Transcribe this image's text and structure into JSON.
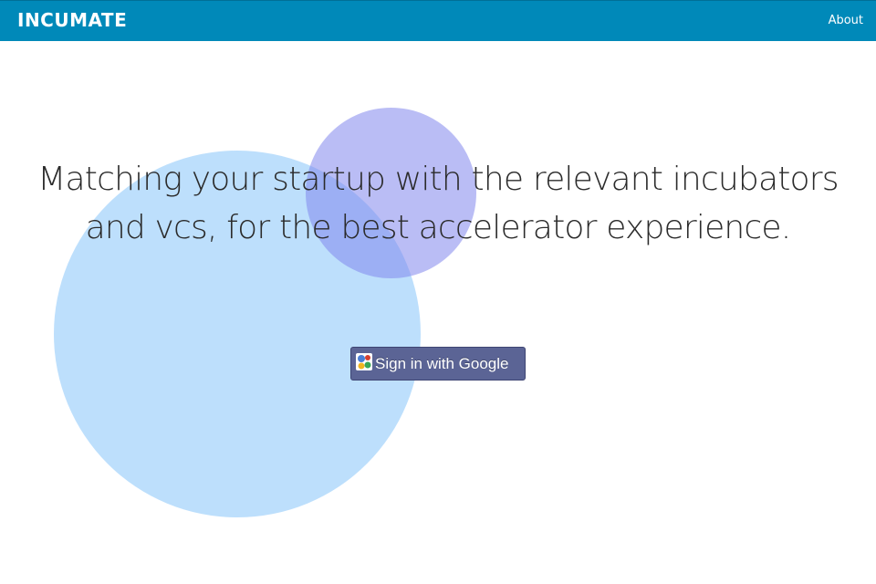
{
  "navbar": {
    "brand": "INCUMATE",
    "about_label": "About"
  },
  "hero": {
    "headline_line1": "Matching your startup with the relevant incubators",
    "headline_line2": "and vcs, for the best accelerator experience."
  },
  "signin": {
    "label": "Sign in with Google",
    "icon": "google-icon"
  },
  "colors": {
    "navbar_bg": "#0089b9",
    "button_bg": "#5b6495",
    "circle_large": "#c3e3fb",
    "circle_small": "#b6b9f3"
  }
}
